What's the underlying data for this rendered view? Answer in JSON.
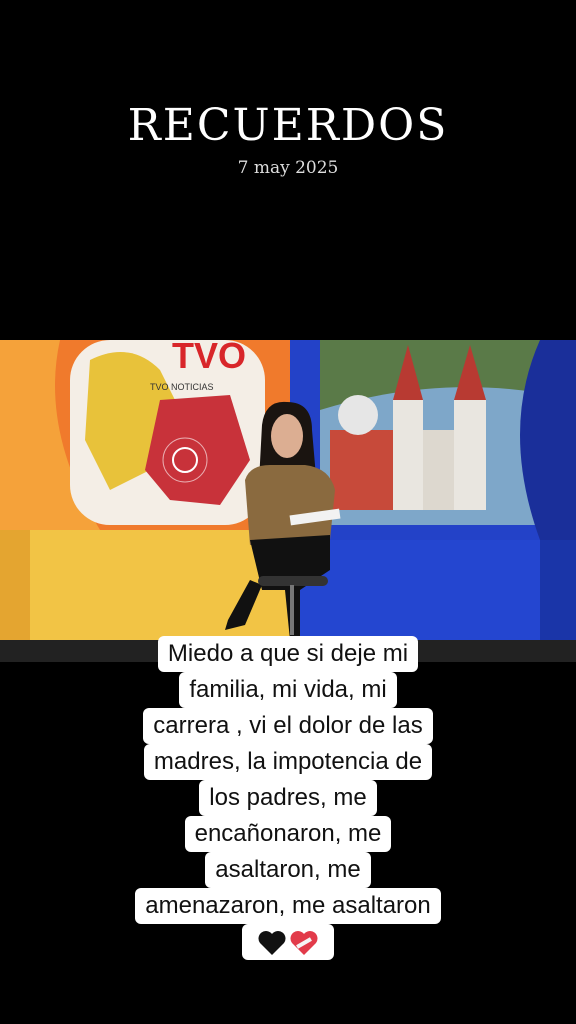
{
  "header": {
    "title": "RECUERDOS",
    "date": "7 may 2025"
  },
  "scene": {
    "logo": "TVO",
    "logo_subtitle": "TVO NOTICIAS"
  },
  "caption": {
    "lines": [
      "Miedo a que si deje mi",
      "familia, mi vida, mi",
      "carrera , vi el dolor de las",
      "madres, la impotencia de",
      "los padres, me",
      "encañonaron, me",
      "asaltaron, me",
      "amenazaron, me asaltaron"
    ],
    "emojis": [
      "black-heart-icon",
      "mending-heart-icon"
    ]
  },
  "colors": {
    "background": "#000000",
    "studio_orange": "#f07a2c",
    "studio_yellow": "#f2c445",
    "studio_blue": "#2342c8",
    "map_red": "#c8323a",
    "map_yellow": "#e8c23a"
  }
}
